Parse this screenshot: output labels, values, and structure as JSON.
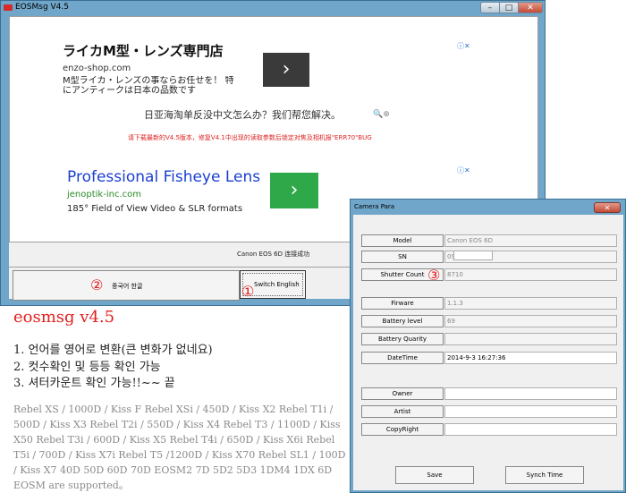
{
  "main_window": {
    "title": "EOSMsg V4.5",
    "buttons": {
      "minimize": "–",
      "maximize": "□",
      "close": "✕"
    },
    "ad1": {
      "title": "ライカM型・レンズ専門店",
      "url": "enzo-shop.com",
      "desc": "M型ライカ・レンズの事ならお任せを！ 特にアンティークは日本の品数です",
      "arrow": "›",
      "choice": "ⓘ✕"
    },
    "notice_cn": "日亚海淘单反没中文怎么办？我们帮您解决。",
    "notice_cn_icon": "🔍⊕",
    "notice_red": "请下载最新的V4.5版本，修复V4.1中出现的读取参数后锁定对焦及相机报\"ERR70\"BUG",
    "ad2": {
      "title": "Professional Fisheye Lens",
      "url": "jenoptik-inc.com",
      "desc": "185° Field of View Video & SLR formats",
      "arrow": "›",
      "choice": "ⓘ✕"
    },
    "camera_name": "Canon EOS 6D 连接成功",
    "switch_hangul": "중국어 한글",
    "switch_english": "Switch English"
  },
  "markers": {
    "one": "①",
    "two": "②",
    "three": "③"
  },
  "blog": {
    "heading": "eosmsg v4.5",
    "items": [
      "1. 언어를 영어로 변환(큰 변화가 없네요)",
      "2. 컷수확인 및 등등 확인 가능",
      "3. 셔터카운트 확인 가능!!~~ 끝"
    ],
    "models": "Rebel XS / 1000D / Kiss F Rebel XSi / 450D / Kiss X2 Rebel T1i / 500D / Kiss X3 Rebel T2i / 550D / Kiss X4 Rebel T3 / 1100D / Kiss X50 Rebel T3i / 600D / Kiss X5 Rebel T4i / 650D / Kiss X6i Rebel T5i / 700D / Kiss X7i Rebel T5 /1200D / Kiss X70 Rebel SL1 / 100D / Kiss X7 40D 50D 60D 70D EOSM2 7D 5D2 5D3 1DM4 1DX 6D EOSM are supported。"
  },
  "camera_para": {
    "title": "Camera Para",
    "close": "✕",
    "rows": [
      {
        "label": "Model",
        "value": "Canon EOS 6D"
      },
      {
        "label": "SN",
        "value": "0S"
      },
      {
        "label": "Shutter Count",
        "value": "8710"
      },
      {
        "label": "Firware",
        "value": "1.1.3"
      },
      {
        "label": "Battery level",
        "value": "69"
      },
      {
        "label": "Battery Quarity",
        "value": ""
      },
      {
        "label": "DateTime",
        "value": "2014-9-3 16:27:36"
      },
      {
        "label": "Owner",
        "value": ""
      },
      {
        "label": "Artist",
        "value": ""
      },
      {
        "label": "CopyRight",
        "value": ""
      }
    ],
    "save": "Save",
    "synch_time": "Synch Time"
  }
}
